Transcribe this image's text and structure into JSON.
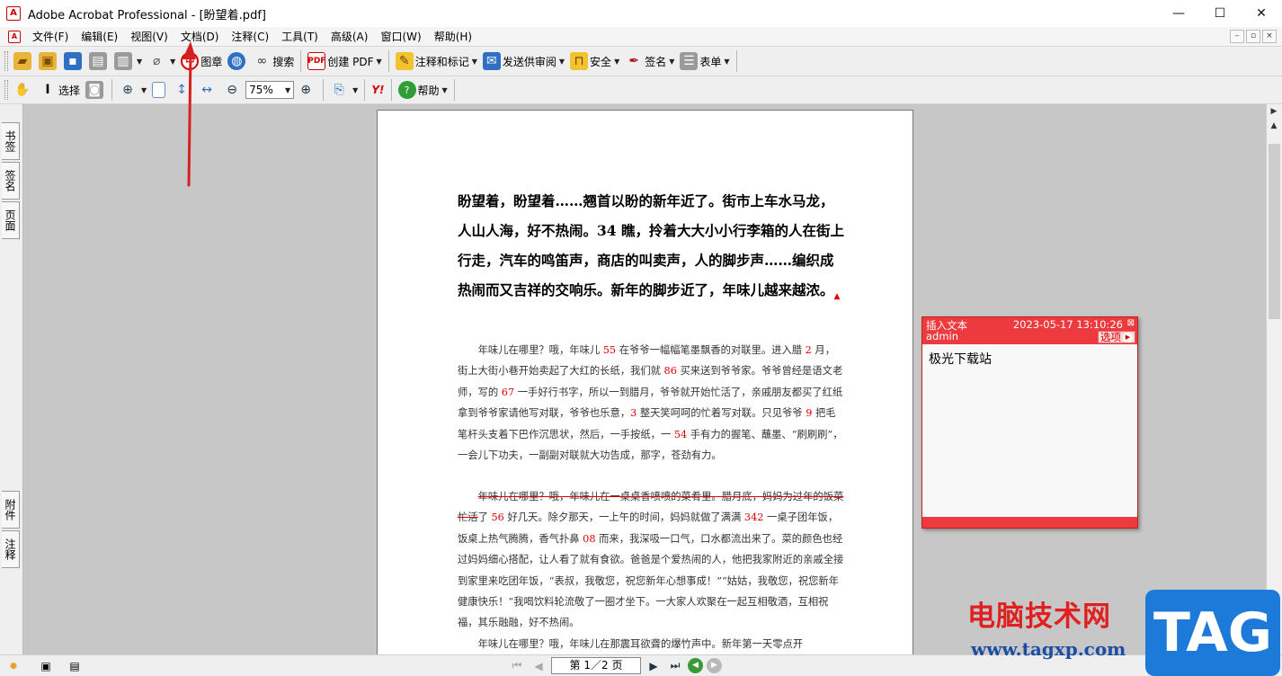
{
  "window": {
    "title": "Adobe Acrobat Professional - [盼望着.pdf]",
    "app_icon": "acrobat-icon",
    "controls": {
      "minimize": "—",
      "maximize": "☐",
      "close": "✕"
    }
  },
  "menu": {
    "items": [
      "文件(F)",
      "编辑(E)",
      "视图(V)",
      "文档(D)",
      "注释(C)",
      "工具(T)",
      "高级(A)",
      "窗口(W)",
      "帮助(H)"
    ],
    "mdi": {
      "minimize": "–",
      "restore": "▫",
      "close": "×"
    }
  },
  "toolbar1": {
    "stamp": "图章",
    "search": "搜索",
    "create_pdf": "创建 PDF",
    "comment_markup": "注释和标记",
    "send_review": "发送供审阅",
    "security": "安全",
    "sign": "签名",
    "forms": "表单"
  },
  "toolbar2": {
    "select": "选择",
    "zoom_value": "75%",
    "help": "帮助"
  },
  "left_tabs": {
    "bookmarks": "书签",
    "signatures": "签名",
    "pages": "页面",
    "attachments": "附件",
    "comments": "注释"
  },
  "document": {
    "lead": "盼望着，盼望着……翘首以盼的新年近了。街市上车水马龙，人山人海，好不热闹。34 瞧，拎着大大小小行李箱的人在街上行走，汽车的鸣笛声，商店的叫卖声，人的脚步声……编织成热闹而又吉祥的交响乐。新年的脚步近了，年味儿越来越浓。",
    "p1": [
      {
        "t": "年味儿在哪里？哦，年味儿 "
      },
      {
        "t": "55",
        "red": true
      },
      {
        "t": " 在爷爷一幅幅笔墨飘香的对联里。进入腊 "
      },
      {
        "t": "2",
        "red": true
      },
      {
        "t": " 月，街上大街小巷开始卖起了大红的长纸，我们就 "
      },
      {
        "t": "86",
        "red": true
      },
      {
        "t": " 买来送到爷爷家。爷爷曾经是语文老师，写的 "
      },
      {
        "t": "67",
        "red": true
      },
      {
        "t": " 一手好行书字，所以一到腊月，爷爷就开始忙活了，亲戚朋友都买了红纸拿到爷爷家请他写对联，爷爷也乐意，"
      },
      {
        "t": "3",
        "red": true
      },
      {
        "t": " 整天笑呵呵的忙着写对联。只见爷爷 "
      },
      {
        "t": "9",
        "red": true
      },
      {
        "t": " 把毛笔杆头支着下巴作沉思状，然后，一手按纸，一 "
      },
      {
        "t": "54",
        "red": true
      },
      {
        "t": " 手有力的握笔、蘸墨、“刷刷刷”，一会儿下功夫，一副副对联就大功告成，那字，苍劲有力。"
      }
    ],
    "p2_strike": "年味儿在哪里？哦，年味儿在一桌桌香喷喷的菜肴里。腊月底，妈妈为过年的饭菜忙活",
    "p2": [
      {
        "t": "了 "
      },
      {
        "t": "56",
        "red": true
      },
      {
        "t": " 好几天。除夕那天，一上午的时间，妈妈就做了满满 "
      },
      {
        "t": "342",
        "red": true
      },
      {
        "t": " 一桌子团年饭，饭桌上热气腾腾，香气扑鼻 "
      },
      {
        "t": "08",
        "red": true
      },
      {
        "t": " 而来，我深吸一口气，口水都流出来了。菜的颜色也经过妈妈细心搭配，让人看了就有食欲。爸爸是个爱热闹的人，他把我家附近的亲戚全接到家里来吃团年饭，“表叔，我敬您，祝您新年心想事成！”“姑姑，我敬您，祝您新年健康快乐！”我喝饮料轮流敬了一圈才坐下。一大家人欢聚在一起互相敬酒，互相祝福，其乐融融，好不热闹。"
      }
    ],
    "p3": "年味儿在哪里？哦，年味儿在那震耳欲聋的爆竹声中。新年第一天零点开"
  },
  "note": {
    "type": "插入文本",
    "author": "admin",
    "datetime": "2023-05-17 13:10:26",
    "options": "选项",
    "close": "⊠",
    "text": "极光下载站"
  },
  "status": {
    "page": "第 1／2 页"
  },
  "watermark": {
    "cn": "电脑技术网",
    "url": "www.tagxp.com",
    "tag": "TAG"
  },
  "colors": {
    "note_red": "#ed3a3e",
    "arrow_red": "#d42020",
    "tag_blue": "#1e7ad9"
  }
}
